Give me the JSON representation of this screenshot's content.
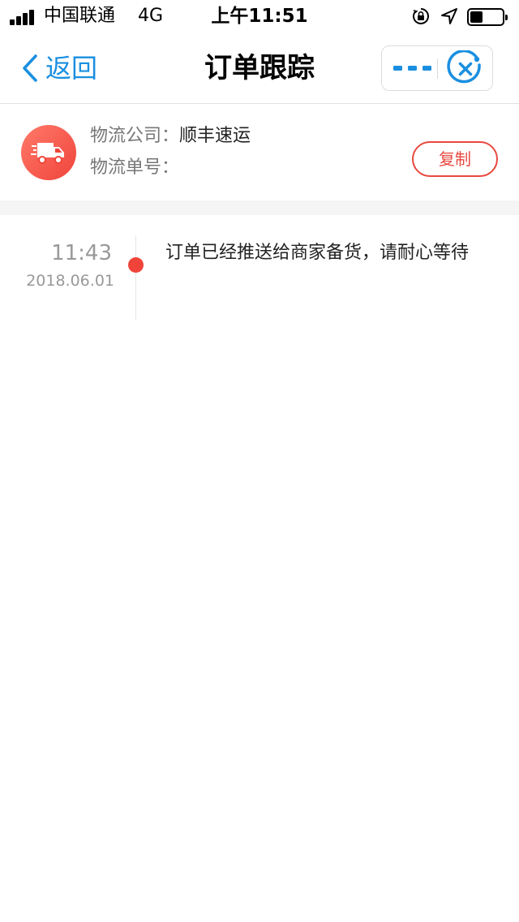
{
  "status_bar": {
    "carrier": "中国联通",
    "network": "4G",
    "time": "上午11:51",
    "battery_level": 0.4,
    "icons": [
      "signal-icon",
      "rotation-lock-icon",
      "location-icon",
      "battery-icon"
    ]
  },
  "nav": {
    "back_label": "返回",
    "title": "订单跟踪",
    "icons": [
      "back-chevron-icon",
      "more-dots-icon",
      "close-circle-icon"
    ]
  },
  "logistics": {
    "company_label": "物流公司：",
    "company_value": "顺丰速运",
    "number_label": "物流单号：",
    "number_value": "",
    "copy_label": "复制",
    "icon": "truck-icon"
  },
  "timeline": {
    "items": [
      {
        "time": "11:43",
        "date": "2018.06.01",
        "description": "订单已经推送给商家备货，请耐心等待"
      }
    ]
  },
  "colors": {
    "accent_blue": "#1a8fe0",
    "accent_red": "#f0443a",
    "text_primary": "#222222",
    "text_secondary": "#999999"
  }
}
